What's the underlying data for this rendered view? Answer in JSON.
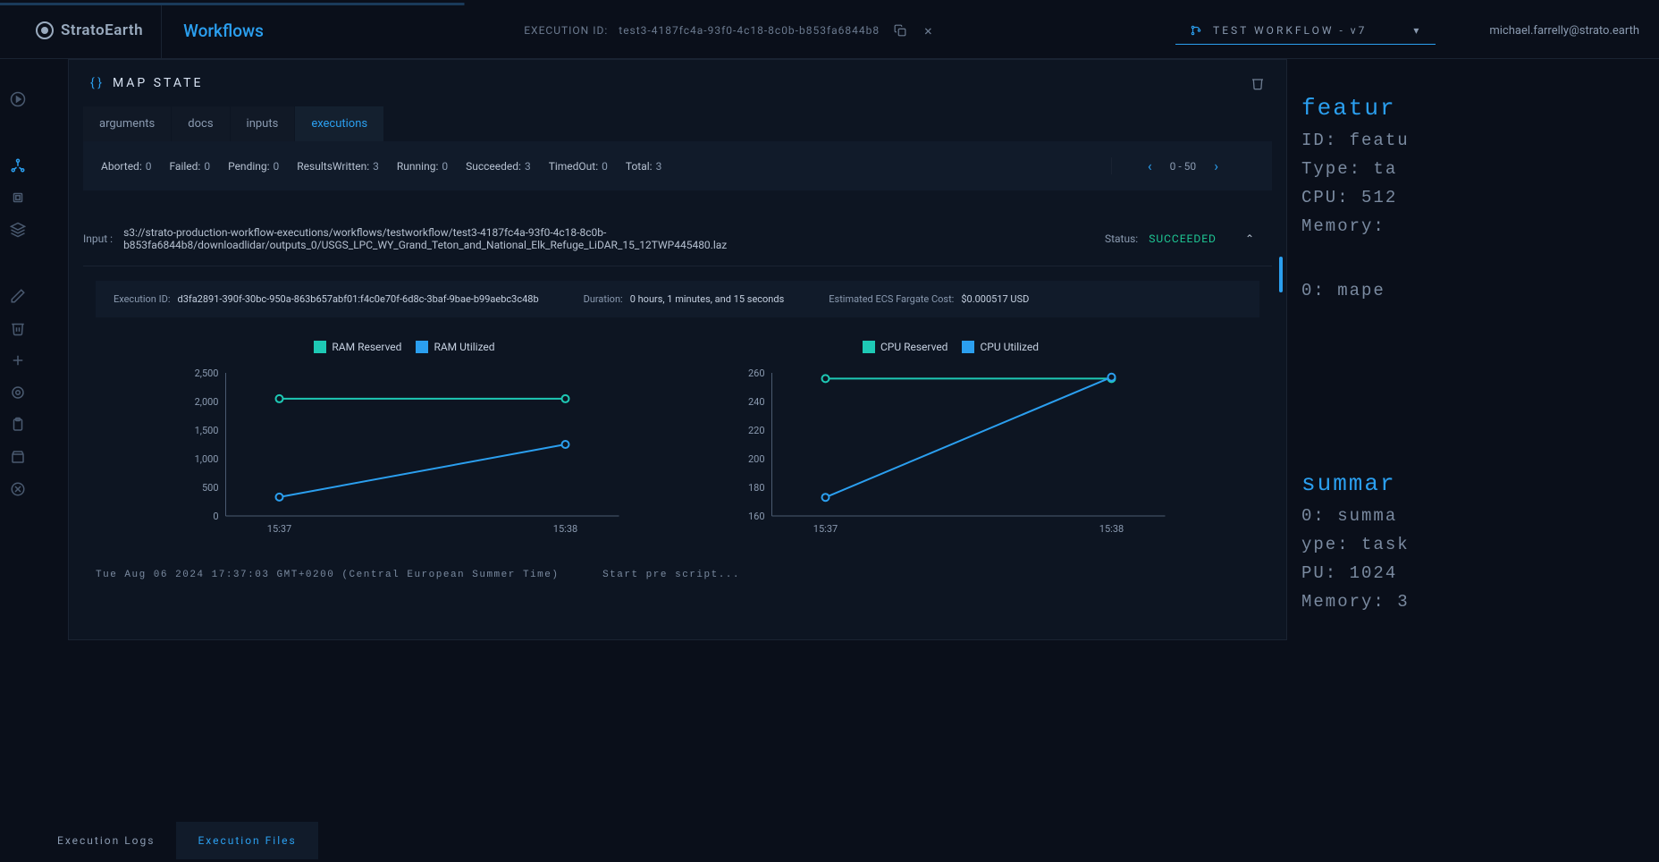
{
  "header": {
    "brand": "StratoEarth",
    "nav_title": "Workflows",
    "exec_id_label": "EXECUTION ID:",
    "exec_id_value": "test3-4187fc4a-93f0-4c18-8c0b-b853fa6844b8",
    "workflow_selector": "TEST WORKFLOW - v7",
    "user_email": "michael.farrelly@strato.earth"
  },
  "modal": {
    "title": "MAP STATE",
    "tabs": [
      "arguments",
      "docs",
      "inputs",
      "executions"
    ],
    "active_tab": 3,
    "stats": {
      "Aborted": "0",
      "Failed": "0",
      "Pending": "0",
      "ResultsWritten": "3",
      "Running": "0",
      "Succeeded": "3",
      "TimedOut": "0",
      "Total": "3"
    },
    "pagination": "0 - 50",
    "input_label": "Input :",
    "input_path": "s3://strato-production-workflow-executions/workflows/testworkflow/test3-4187fc4a-93f0-4c18-8c0b-b853fa6844b8/downloadlidar/outputs_0/USGS_LPC_WY_Grand_Teton_and_National_Elk_Refuge_LiDAR_15_12TWP445480.laz",
    "status_label": "Status:",
    "status_value": "SUCCEEDED",
    "details": {
      "exec_id_label": "Execution ID:",
      "exec_id_value": "d3fa2891-390f-30bc-950a-863b657abf01:f4c0e70f-6d8c-3baf-9bae-b99aebc3c48b",
      "duration_label": "Duration:",
      "duration_value": "0 hours, 1 minutes, and 15 seconds",
      "cost_label": "Estimated ECS Fargate Cost:",
      "cost_value": "$0.000517 USD"
    },
    "log_timestamp": "Tue Aug 06 2024 17:37:03 GMT+0200 (Central European Summer Time)",
    "log_message": "Start pre script..."
  },
  "chart_data": [
    {
      "type": "line",
      "title": "RAM",
      "x": [
        "15:37",
        "15:38"
      ],
      "series": [
        {
          "name": "RAM Reserved",
          "values": [
            2048,
            2048
          ],
          "color": "#1ec9b5"
        },
        {
          "name": "RAM Utilized",
          "values": [
            330,
            1250
          ],
          "color": "#2b9fef"
        }
      ],
      "ylim": [
        0,
        2500
      ],
      "yticks": [
        0,
        500,
        1000,
        1500,
        2000,
        2500
      ]
    },
    {
      "type": "line",
      "title": "CPU",
      "x": [
        "15:37",
        "15:38"
      ],
      "series": [
        {
          "name": "CPU Reserved",
          "values": [
            256,
            256
          ],
          "color": "#1ec9b5"
        },
        {
          "name": "CPU Utilized",
          "values": [
            173,
            257
          ],
          "color": "#2b9fef"
        }
      ],
      "ylim": [
        160,
        260
      ],
      "yticks": [
        160,
        180,
        200,
        220,
        240,
        260
      ]
    }
  ],
  "bg_panel": {
    "heading1": "featur",
    "lines1": [
      "ID: featu",
      "Type: ta",
      "CPU: 512",
      "Memory:"
    ],
    "mid": "0: mape",
    "heading2": "summar",
    "lines2": [
      "0: summa",
      "ype: task",
      "PU: 1024",
      "Memory: 3"
    ]
  },
  "bottom_tabs": {
    "items": [
      "Execution Logs",
      "Execution Files"
    ],
    "active": 1
  }
}
